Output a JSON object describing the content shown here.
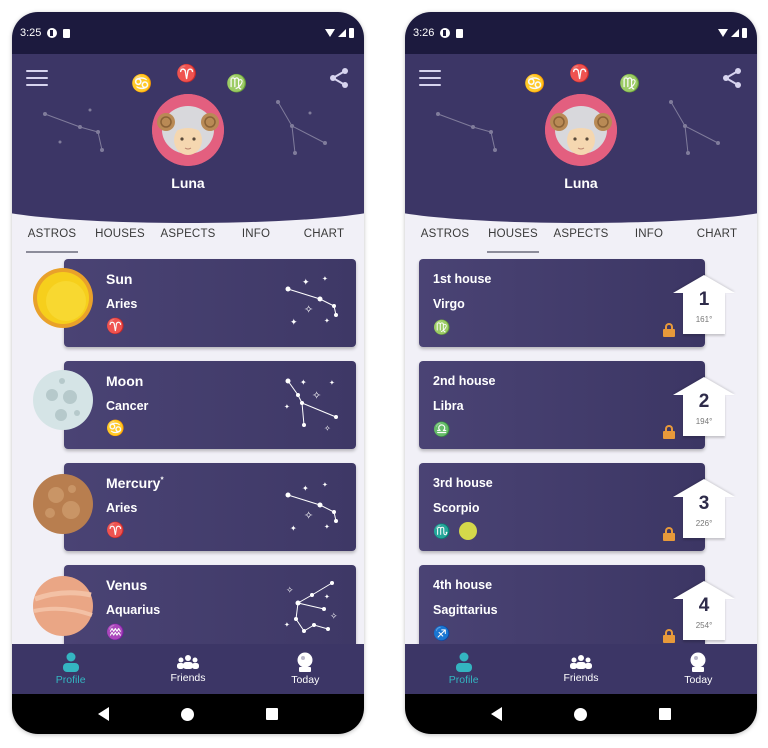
{
  "colors": {
    "header": "#3c3666",
    "status_bar": "#1c1a3e",
    "active_nav": "#34b5c1",
    "lock": "#e89a3a"
  },
  "screens": [
    {
      "status": {
        "time": "3:25"
      },
      "header": {
        "zodiac": [
          "♋",
          "♈",
          "♍"
        ],
        "user_name": "Luna"
      },
      "tabs": [
        "ASTROS",
        "HOUSES",
        "ASPECTS",
        "INFO",
        "CHART"
      ],
      "active_tab": "ASTROS",
      "astros": [
        {
          "planet": "Sun",
          "sign": "Aries",
          "glyph": "♈",
          "icon": "sun-icon"
        },
        {
          "planet": "Moon",
          "sign": "Cancer",
          "glyph": "♋",
          "icon": "moon-icon"
        },
        {
          "planet": "Mercury",
          "marker": "*",
          "sign": "Aries",
          "glyph": "♈",
          "icon": "mercury-icon"
        },
        {
          "planet": "Venus",
          "sign": "Aquarius",
          "glyph": "♒",
          "icon": "venus-icon"
        }
      ],
      "bottom_nav": [
        {
          "label": "Profile",
          "icon": "profile-icon",
          "active": true
        },
        {
          "label": "Friends",
          "icon": "friends-icon",
          "active": false
        },
        {
          "label": "Today",
          "icon": "crystal-ball-icon",
          "active": false
        }
      ]
    },
    {
      "status": {
        "time": "3:26"
      },
      "header": {
        "zodiac": [
          "♋",
          "♈",
          "♍"
        ],
        "user_name": "Luna"
      },
      "tabs": [
        "ASTROS",
        "HOUSES",
        "ASPECTS",
        "INFO",
        "CHART"
      ],
      "active_tab": "HOUSES",
      "houses": [
        {
          "title": "1st house",
          "sign": "Virgo",
          "glyph": "♍",
          "number": "1",
          "degree": "161°",
          "has_planet": false
        },
        {
          "title": "2nd house",
          "sign": "Libra",
          "glyph": "♎",
          "number": "2",
          "degree": "194°",
          "has_planet": false
        },
        {
          "title": "3rd house",
          "sign": "Scorpio",
          "glyph": "♏",
          "number": "3",
          "degree": "226°",
          "has_planet": true
        },
        {
          "title": "4th house",
          "sign": "Sagittarius",
          "glyph": "♐",
          "number": "4",
          "degree": "254°",
          "has_planet": false
        }
      ],
      "bottom_nav": [
        {
          "label": "Profile",
          "icon": "profile-icon",
          "active": true
        },
        {
          "label": "Friends",
          "icon": "friends-icon",
          "active": false
        },
        {
          "label": "Today",
          "icon": "crystal-ball-icon",
          "active": false
        }
      ]
    }
  ]
}
